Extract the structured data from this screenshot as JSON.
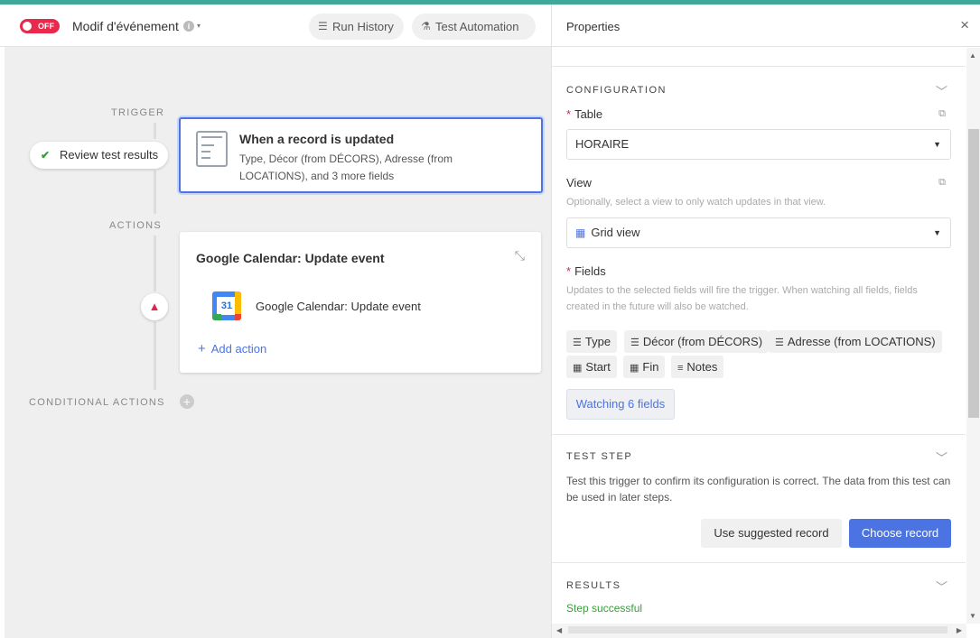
{
  "toolbar": {
    "toggle_label": "OFF",
    "automation_name": "Modif d'événement",
    "info_glyph": "i",
    "caret_glyph": "▾",
    "run_history_label": "Run History",
    "test_automation_label": "Test Automation"
  },
  "canvas": {
    "trigger_section": "TRIGGER",
    "actions_section": "ACTIONS",
    "conditional_section": "CONDITIONAL ACTIONS",
    "review_button": "Review test results",
    "trigger_card": {
      "title": "When a record is updated",
      "subtitle": "Type, Décor (from DÉCORS), Adresse (from LOCATIONS), and 3 more fields"
    },
    "action_card": {
      "title": "Google Calendar: Update event",
      "step_label": "Google Calendar: Update event",
      "calendar_day": "31",
      "add_action_label": "Add action",
      "plus_glyph": "+"
    },
    "warning_glyph": "▲",
    "add_conditional_glyph": "+"
  },
  "properties": {
    "title": "Properties",
    "close_glyph": "×",
    "configuration": {
      "heading": "CONFIGURATION",
      "table_label": "Table",
      "table_value": "HORAIRE",
      "view_label": "View",
      "view_help": "Optionally, select a view to only watch updates in that view.",
      "view_value": "Grid view",
      "fields_label": "Fields",
      "fields_help": "Updates to the selected fields will fire the trigger. When watching all fields, fields created in the future will also be watched.",
      "field_chips": [
        {
          "icon": "☰",
          "label": "Type"
        },
        {
          "icon": "☰",
          "label": "Décor (from DÉCORS)"
        },
        {
          "icon": "☰",
          "label": "Adresse (from LOCATIONS)"
        },
        {
          "icon": "▦",
          "label": "Start"
        },
        {
          "icon": "▦",
          "label": "Fin"
        },
        {
          "icon": "≡",
          "label": "Notes"
        }
      ],
      "watching_label": "Watching 6 fields"
    },
    "test_step": {
      "heading": "TEST STEP",
      "description": "Test this trigger to confirm its configuration is correct. The data from this test can be used in later steps.",
      "suggested_button": "Use suggested record",
      "choose_button": "Choose record"
    },
    "results": {
      "heading": "RESULTS",
      "status": "Step successful"
    }
  },
  "colors": {
    "accent": "#4b74e2",
    "toggle_off": "#e8294c",
    "success": "#3a9d3a",
    "top_strip": "#3fa89b"
  }
}
